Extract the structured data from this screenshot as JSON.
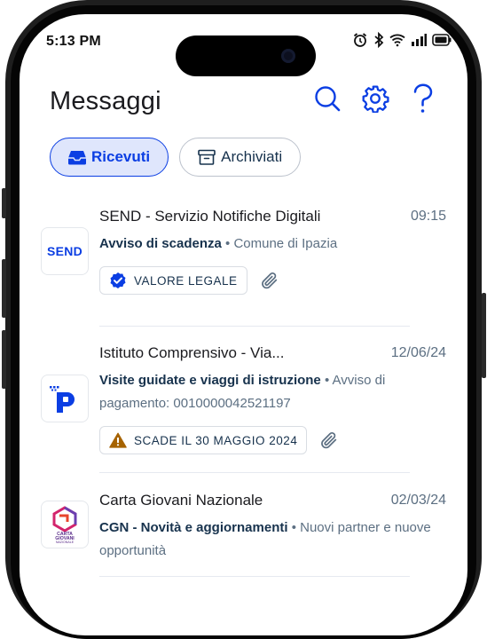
{
  "status_bar": {
    "time": "5:13 PM"
  },
  "header": {
    "title": "Messaggi",
    "icons": [
      "search-icon",
      "settings-icon",
      "help-icon"
    ]
  },
  "tabs": [
    {
      "label": "Ricevuti",
      "icon": "inbox-icon",
      "active": true
    },
    {
      "label": "Archiviati",
      "icon": "archive-icon",
      "active": false
    }
  ],
  "messages": [
    {
      "sender": "SEND - Servizio Notifiche Digitali",
      "date": "09:15",
      "subject": "Avviso di scadenza",
      "separator": " • ",
      "detail": "Comune di Ipazia",
      "logo_text": "SEND",
      "badge": {
        "label": "VALORE LEGALE",
        "icon": "verified-check-icon"
      },
      "attachment": true
    },
    {
      "sender": "Istituto Comprensivo - Via...",
      "date": "12/06/24",
      "subject": "Visite guidate e viaggi di istruzione",
      "separator": " • ",
      "detail": "Avviso di pagamento: 0010000042521197",
      "logo_text": "P",
      "badge": {
        "label": "SCADE IL 30 MAGGIO 2024",
        "icon": "warning-icon"
      },
      "attachment": true
    },
    {
      "sender": "Carta Giovani Nazionale",
      "date": "02/03/24",
      "subject": "CGN - Novità e aggiornamenti",
      "separator": " • ",
      "detail": "Nuovi partner e nuove opportunità",
      "logo_text": "CARTA GIOVANI NAZIONALE"
    }
  ],
  "colors": {
    "primary": "#0b3ee3",
    "tab_active_bg": "#dfe6fc",
    "text_dark": "#17324d",
    "text_muted": "#5c6f82",
    "warning": "#a66300"
  }
}
